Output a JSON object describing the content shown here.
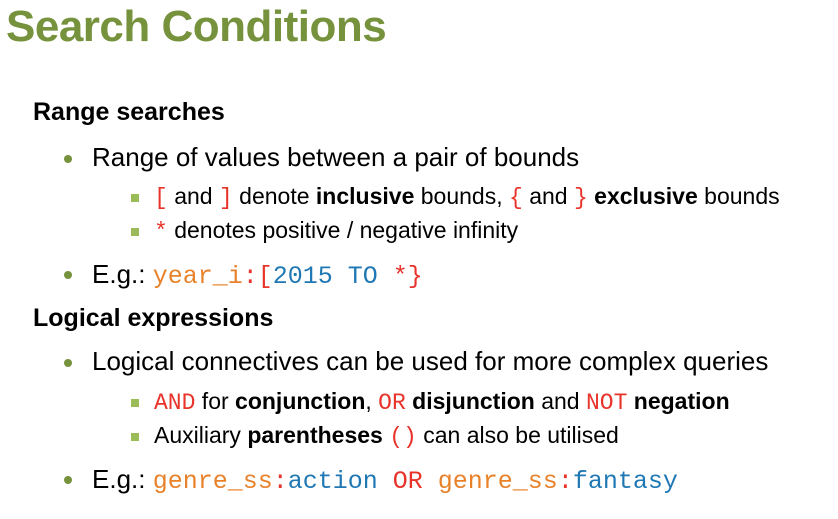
{
  "title": "Search Conditions",
  "section1": {
    "heading": "Range searches",
    "bullet1": "Range of values between a pair of bounds",
    "sub1": {
      "open_inc": "[",
      "and1": " and ",
      "close_inc": "]",
      "denote": " denote ",
      "inclusive": "inclusive",
      "bounds_comma": " bounds, ",
      "open_exc": "{",
      "and2": " and ",
      "close_exc": "}",
      "space": " ",
      "exclusive": "exclusive",
      "bounds": " bounds"
    },
    "sub2": {
      "star": "*",
      "text": " denotes positive / negative infinity"
    },
    "example": {
      "prefix": "E.g.: ",
      "field": "year_i",
      "colon": ":",
      "open": "[",
      "range": "2015 TO ",
      "star": "*",
      "close": "}"
    }
  },
  "section2": {
    "heading": "Logical expressions",
    "bullet1": "Logical connectives can be used for more complex queries",
    "sub1": {
      "and_kw": "AND",
      "for": " for ",
      "conjunction": "conjunction",
      "comma": ", ",
      "or_kw": "OR",
      "sp1": " ",
      "disjunction": "disjunction",
      "and_word": " and ",
      "not_kw": "NOT",
      "sp2": " ",
      "negation": "negation"
    },
    "sub2": {
      "aux": "Auxiliary ",
      "parentheses": "parentheses",
      "sp": " ",
      "parens": "()",
      "rest": " can also be utilised"
    },
    "example": {
      "prefix": "E.g.: ",
      "field1": "genre_ss",
      "colon1": ":",
      "value1": "action",
      "or_kw": " OR ",
      "field2": "genre_ss",
      "colon2": ":",
      "value2": "fantasy"
    }
  },
  "colors": {
    "title": "#76923c",
    "bullet": "#76923c",
    "sub_bullet": "#9bbb59",
    "code_red": "#e8332b",
    "code_orange": "#e8822a",
    "code_blue": "#1f78b4"
  }
}
